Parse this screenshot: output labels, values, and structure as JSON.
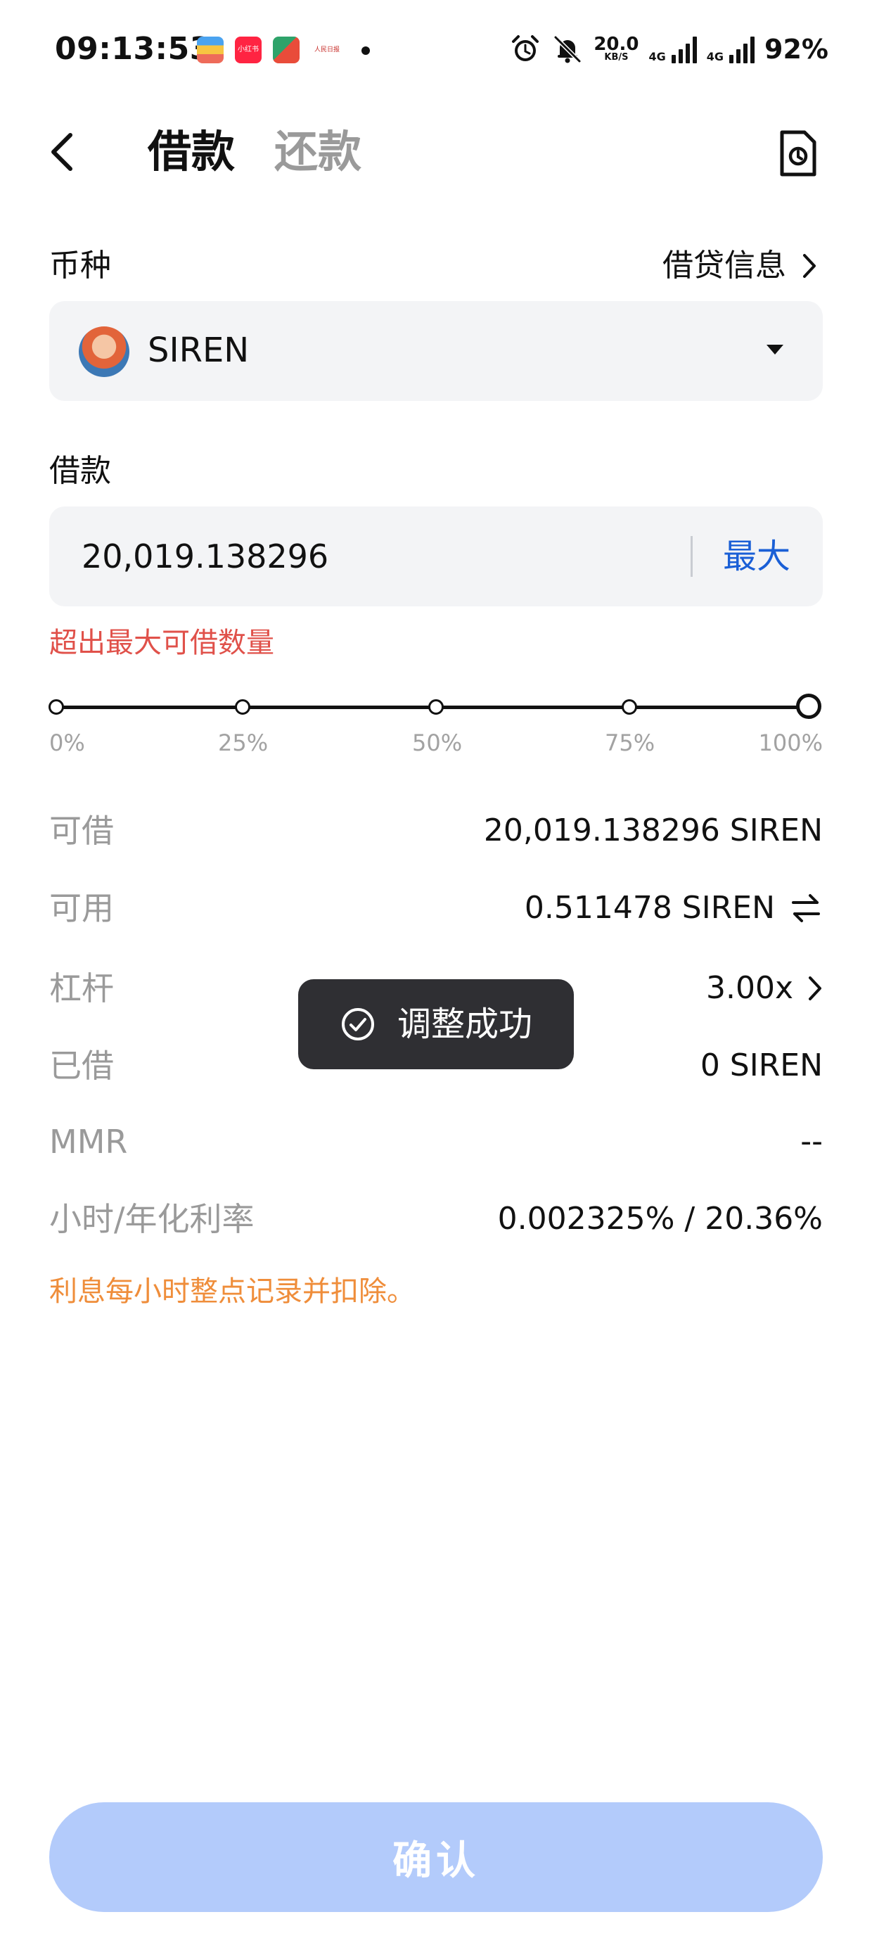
{
  "status_bar": {
    "time": "09:13:53",
    "app_icons": [
      "wallet-app-icon",
      "xiaohongshu-app-icon",
      "news-app-icon",
      "people-daily-app-icon"
    ],
    "app_icon_labels": [
      "",
      "小红书",
      "",
      "人民日报"
    ],
    "net_speed_value": "20.0",
    "net_speed_unit": "KB/S",
    "network_1": "4G",
    "network_2": "4G",
    "battery": "92%"
  },
  "header": {
    "tab_borrow": "借款",
    "tab_repay": "还款",
    "active_tab": "借款"
  },
  "currency": {
    "label": "币种",
    "info_link": "借贷信息",
    "selected_coin": "SIREN"
  },
  "borrow": {
    "label": "借款",
    "amount_value": "20,019.138296",
    "max_label": "最大",
    "error_text": "超出最大可借数量"
  },
  "slider": {
    "marks": [
      "0%",
      "25%",
      "50%",
      "75%",
      "100%"
    ],
    "value_percent": 100
  },
  "info": {
    "borrowable_label": "可借",
    "borrowable_value": "20,019.138296 SIREN",
    "available_label": "可用",
    "available_value": "0.511478 SIREN",
    "leverage_label": "杠杆",
    "leverage_value": "3.00x",
    "borrowed_label": "已借",
    "borrowed_value": "0 SIREN",
    "mmr_label": "MMR",
    "mmr_value": "--",
    "rate_label": "小时/年化利率",
    "rate_value": "0.002325% / 20.36%"
  },
  "note": "利息每小时整点记录并扣除。",
  "toast": {
    "text": "调整成功"
  },
  "confirm_button": "确认",
  "colors": {
    "accent": "#1a5fd6",
    "error": "#e0514a",
    "note": "#ef8d3a",
    "confirm_disabled": "#b3cbfb",
    "toast_bg": "#2f2f33"
  }
}
